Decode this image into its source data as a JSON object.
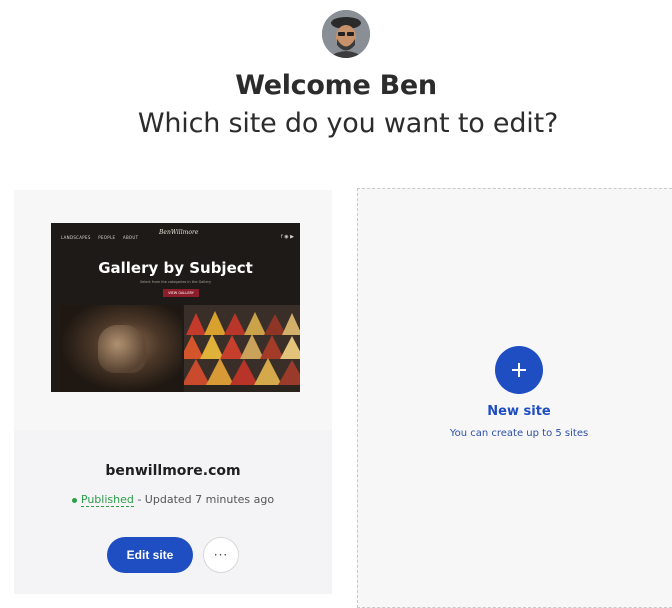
{
  "header": {
    "welcome": "Welcome Ben",
    "question": "Which site do you want to edit?"
  },
  "site": {
    "preview": {
      "nav": [
        "LANDSCAPES",
        "PEOPLE",
        "ABOUT"
      ],
      "logo": "BenWillmore",
      "title": "Gallery by Subject",
      "tagline": "Select from the categories in the Gallery",
      "cta": "VIEW GALLERY",
      "social": "f ◉ ▶"
    },
    "name": "benwillmore.com",
    "status": "Published",
    "updated": "- Updated 7 minutes ago",
    "edit_label": "Edit site",
    "more_label": "···"
  },
  "new_site": {
    "title": "New site",
    "subtitle": "You can create up to 5 sites"
  },
  "colors": {
    "accent": "#1e4ec2",
    "published": "#2d9d4a",
    "card_bg": "#f7f7f8"
  },
  "icons": {
    "avatar": "user-avatar",
    "plus": "plus-icon",
    "more": "ellipsis-icon",
    "status": "status-dot-icon"
  }
}
